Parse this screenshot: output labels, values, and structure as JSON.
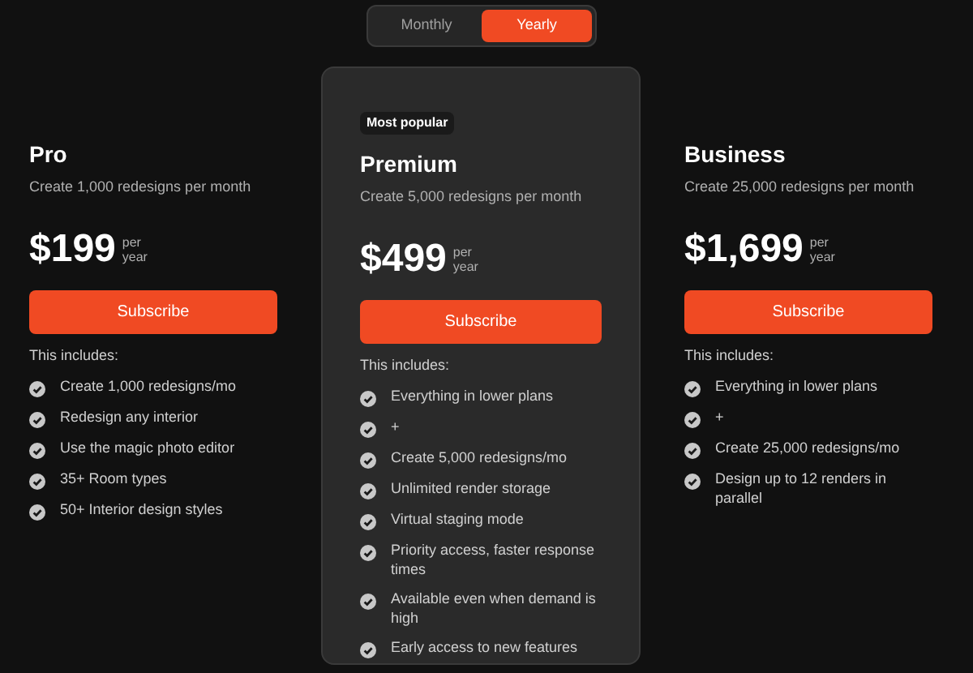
{
  "billing_toggle": [
    {
      "label": "Monthly",
      "selected": false
    },
    {
      "label": "Yearly",
      "selected": true
    }
  ],
  "plans": [
    {
      "name": "Pro",
      "featured": false,
      "description": "Create 1,000 redesigns per month",
      "price": "$199",
      "period_top": "per",
      "period_bottom": "year",
      "button": "Subscribe",
      "includes_label": "This includes:",
      "features": [
        "Create 1,000 redesigns/mo",
        "Redesign any interior",
        "Use the magic photo editor",
        "35+ Room types",
        "50+ Interior design styles"
      ]
    },
    {
      "name": "Premium",
      "featured": true,
      "badge": "Most popular",
      "description": "Create 5,000 redesigns per month",
      "price": "$499",
      "period_top": "per",
      "period_bottom": "year",
      "button": "Subscribe",
      "includes_label": "This includes:",
      "features": [
        "Everything in lower plans",
        "+",
        "Create 5,000 redesigns/mo",
        "Unlimited render storage",
        "Virtual staging mode",
        "Priority access, faster response times",
        "Available even when demand is high",
        "Early access to new features"
      ]
    },
    {
      "name": "Business",
      "featured": false,
      "description": "Create 25,000 redesigns per month",
      "price": "$1,699",
      "period_top": "per",
      "period_bottom": "year",
      "button": "Subscribe",
      "includes_label": "This includes:",
      "features": [
        "Everything in lower plans",
        "+",
        "Create 25,000 redesigns/mo",
        "Design up to 12 renders in parallel"
      ]
    }
  ]
}
